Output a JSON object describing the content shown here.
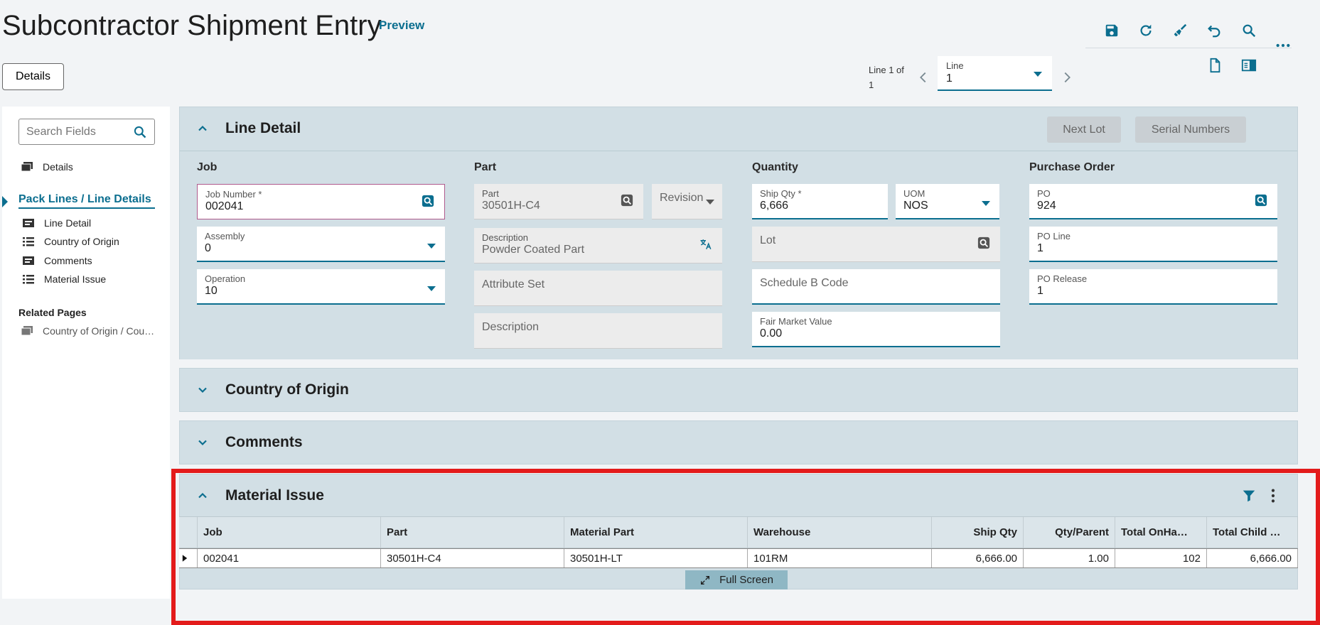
{
  "header": {
    "title": "Subcontractor Shipment Entry",
    "preview": "Preview",
    "details_button": "Details"
  },
  "toolbar": {
    "icons": [
      "save-icon",
      "refresh-icon",
      "clear-icon",
      "undo-icon",
      "search-icon",
      "more-icon",
      "new-document-icon",
      "panel-toggle-icon"
    ]
  },
  "line_nav": {
    "counter": "Line 1 of 1",
    "label": "Line",
    "value": "1"
  },
  "sidebar": {
    "search_placeholder": "Search Fields",
    "top_item": "Details",
    "section_title": "Pack Lines / Line Details",
    "items": [
      {
        "label": "Line Detail",
        "icon": "form-icon"
      },
      {
        "label": "Country of Origin",
        "icon": "list-icon"
      },
      {
        "label": "Comments",
        "icon": "form-icon"
      },
      {
        "label": "Material Issue",
        "icon": "list-icon"
      }
    ],
    "related_title": "Related Pages",
    "related_items": [
      {
        "label": "Country of Origin / Cou…"
      }
    ]
  },
  "line_detail": {
    "title": "Line Detail",
    "next_lot": "Next Lot",
    "serial_numbers": "Serial Numbers",
    "job": {
      "group": "Job",
      "job_number_label": "Job Number *",
      "job_number": "002041",
      "assembly_label": "Assembly",
      "assembly": "0",
      "operation_label": "Operation",
      "operation": "10"
    },
    "part": {
      "group": "Part",
      "part_label": "Part",
      "part": "30501H-C4",
      "revision": "Revision",
      "description_label": "Description",
      "description": "Powder Coated Part",
      "attribute_set": "Attribute Set",
      "description_placeholder": "Description"
    },
    "quantity": {
      "group": "Quantity",
      "ship_qty_label": "Ship Qty *",
      "ship_qty": "6,666",
      "uom_label": "UOM",
      "uom": "NOS",
      "lot": "Lot",
      "schedule_b": "Schedule B Code",
      "fmv_label": "Fair Market Value",
      "fmv": "0.00"
    },
    "purchase_order": {
      "group": "Purchase Order",
      "po_label": "PO",
      "po": "924",
      "po_line_label": "PO Line",
      "po_line": "1",
      "po_release_label": "PO Release",
      "po_release": "1"
    }
  },
  "country_of_origin": {
    "title": "Country of Origin"
  },
  "comments": {
    "title": "Comments"
  },
  "material_issue": {
    "title": "Material Issue",
    "columns": [
      "Job",
      "Part",
      "Material Part",
      "Warehouse",
      "Ship Qty",
      "Qty/Parent",
      "Total OnHa…",
      "Total Child …"
    ],
    "rows": [
      [
        "002041",
        "30501H-C4",
        "30501H-LT",
        "101RM",
        "6,666.00",
        "1.00",
        "102",
        "6,666.00"
      ]
    ],
    "full_screen": "Full Screen"
  },
  "colors": {
    "accent": "#0b6e8f",
    "panel": "#d2dfe5",
    "highlight": "#e31b1b"
  }
}
